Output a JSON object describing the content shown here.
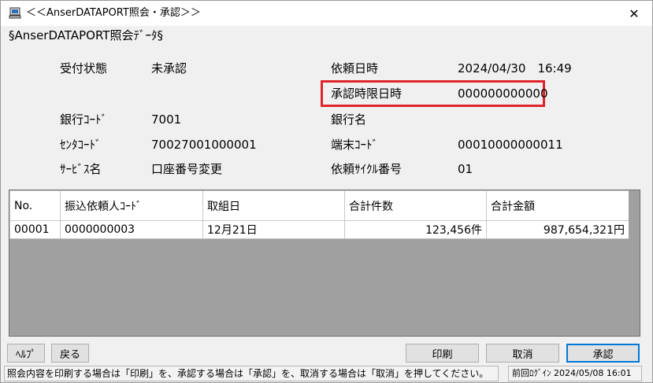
{
  "window": {
    "title": "＜＜AnserDATAPORT照会・承認＞＞",
    "close_glyph": "✕"
  },
  "section_title": "§AnserDATAPORT照会ﾃﾞｰﾀ§",
  "fields": {
    "reception_status_label": "受付状態",
    "reception_status_value": "未承認",
    "request_datetime_label": "依頼日時",
    "request_datetime_value": "2024/04/30　16:49",
    "approval_deadline_label": "承認時限日時",
    "approval_deadline_value": "000000000000",
    "bank_code_label": "銀行ｺｰﾄﾞ",
    "bank_code_value": "7001",
    "bank_name_label": "銀行名",
    "bank_name_value": "",
    "center_code_label": "ｾﾝﾀｺｰﾄﾞ",
    "center_code_value": "70027001000001",
    "terminal_code_label": "端末ｺｰﾄﾞ",
    "terminal_code_value": "00010000000011",
    "service_name_label": "ｻｰﾋﾞｽ名",
    "service_name_value": "口座番号変更",
    "request_cycle_label": "依頼ｻｲｸﾙ番号",
    "request_cycle_value": "01"
  },
  "table": {
    "headers": [
      "No.",
      "振込依頼人ｺｰﾄﾞ",
      "取組日",
      "合計件数",
      "合計金額"
    ],
    "rows": [
      [
        "00001",
        "0000000003",
        "12月21日",
        "123,456件",
        "987,654,321円"
      ]
    ]
  },
  "buttons": {
    "help": "ﾍﾙﾌﾟ",
    "back": "戻る",
    "print": "印刷",
    "cancel": "取消",
    "approve": "承認"
  },
  "status": {
    "message": "照会内容を印刷する場合は「印刷」を、承認する場合は「承認」を、取消する場合は「取消」を押してください。",
    "last_login": "前回ﾛｸﾞｲﾝ 2024/05/08 16:01"
  },
  "colors": {
    "highlight": "#e0242a",
    "grid_background": "#a0a0a0"
  }
}
